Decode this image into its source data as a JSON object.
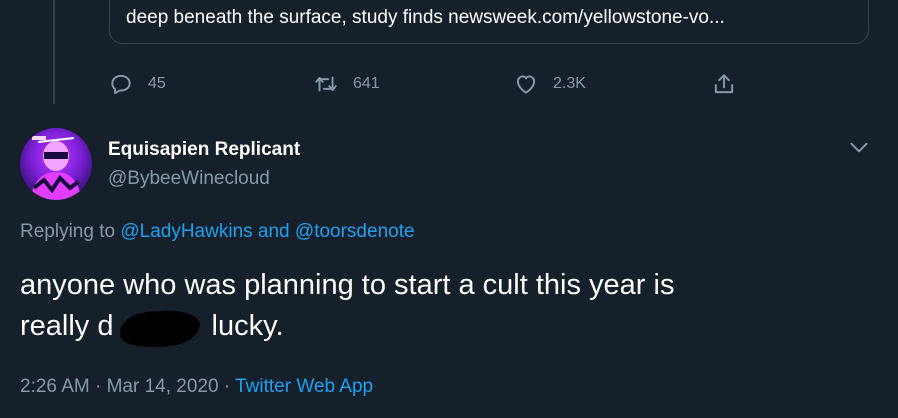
{
  "quoted_card": {
    "text": "deep beneath the surface, study finds newsweek.com/yellowstone-vo..."
  },
  "actions": {
    "reply": {
      "icon": "reply-icon",
      "count": "45"
    },
    "retweet": {
      "icon": "retweet-icon",
      "count": "641"
    },
    "like": {
      "icon": "heart-icon",
      "count": "2.3K"
    },
    "share": {
      "icon": "share-icon"
    }
  },
  "tweet": {
    "display_name": "Equisapien Replicant",
    "handle": "@BybeeWinecloud",
    "replying_prefix": "Replying to",
    "mention_1": "@LadyHawkins",
    "mention_joiner": "and",
    "mention_2": "@toorsdenote",
    "text_line1": "anyone who was planning to start a cult this year is",
    "text_line2_start": "really d",
    "text_line2_end": " lucky.",
    "time": "2:26 AM",
    "sep1": "·",
    "date": "Mar 14, 2020",
    "sep2": "·",
    "source": "Twitter Web App"
  },
  "colors": {
    "background": "#15202b",
    "secondary_text": "#8899a6",
    "link": "#1da1f2",
    "border": "#38444d"
  }
}
